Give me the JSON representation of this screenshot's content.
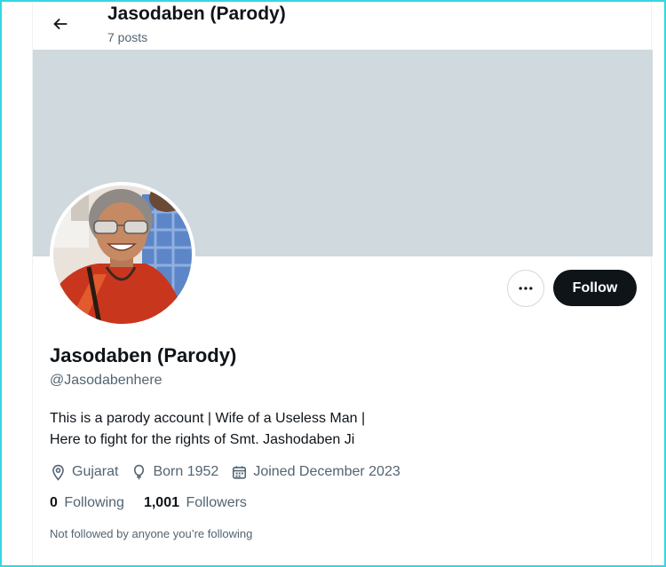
{
  "header": {
    "title": "Jasodaben (Parody)",
    "posts_count": "7 posts",
    "back_icon": "arrow-left-icon"
  },
  "colors": {
    "banner": "#cfd9de",
    "follow_bg": "#0f1419",
    "text_primary": "#0f1419",
    "text_secondary": "#536471",
    "frame_border": "#36d6e0"
  },
  "actions": {
    "more_icon": "more-horizontal-icon",
    "follow_label": "Follow"
  },
  "profile": {
    "display_name": "Jasodaben (Parody)",
    "handle": "@Jasodabenhere",
    "bio_lines": [
      "This is a parody account | Wife of a Useless Man |",
      "Here to fight for the rights of Smt. Jashodaben Ji"
    ],
    "location": "Gujarat",
    "born": "Born 1952",
    "joined": "Joined December 2023",
    "location_icon": "location-pin-icon",
    "born_icon": "balloon-icon",
    "joined_icon": "calendar-icon"
  },
  "stats": {
    "following_count": "0",
    "following_label": "Following",
    "followers_count": "1,001",
    "followers_label": "Followers"
  },
  "followed_note": "Not followed by anyone you’re following"
}
